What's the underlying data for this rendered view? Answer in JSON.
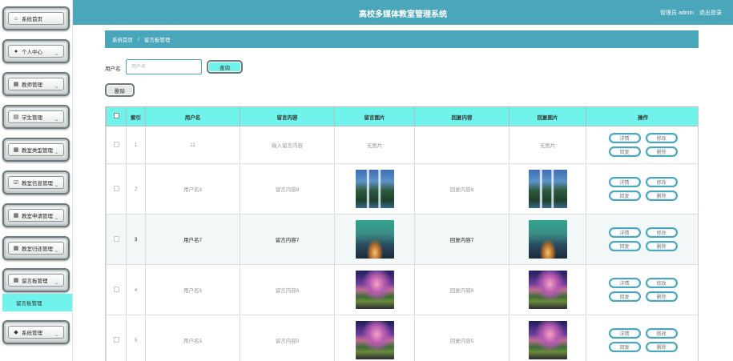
{
  "header": {
    "title": "高校多媒体教室管理系统",
    "user_label": "管理员 admin",
    "logout": "退出登录"
  },
  "sidebar": {
    "items": [
      {
        "label": "系统首页",
        "icon": "home-icon",
        "glyph": "⌂",
        "has_arrow": false
      },
      {
        "label": "个人中心",
        "icon": "user-icon",
        "glyph": "●",
        "has_arrow": true
      },
      {
        "label": "教师管理",
        "icon": "grid-icon",
        "glyph": "▦",
        "has_arrow": true
      },
      {
        "label": "学生管理",
        "icon": "briefcase-icon",
        "glyph": "▤",
        "has_arrow": true
      },
      {
        "label": "教室类型管理",
        "icon": "grid-icon",
        "glyph": "▦",
        "has_arrow": true
      },
      {
        "label": "教室信息管理",
        "icon": "checkbox-icon",
        "glyph": "☑",
        "has_arrow": true
      },
      {
        "label": "教室申请管理",
        "icon": "grid-icon",
        "glyph": "▦",
        "has_arrow": true
      },
      {
        "label": "教室归还管理",
        "icon": "grid-icon",
        "glyph": "▦",
        "has_arrow": true
      },
      {
        "label": "留言板管理",
        "icon": "grid-icon",
        "glyph": "▦",
        "has_arrow": true
      },
      {
        "label": "系统管理",
        "icon": "location-icon",
        "glyph": "◆",
        "has_arrow": true
      }
    ],
    "active_sub": "留言板管理"
  },
  "breadcrumb": {
    "home": "系统首页",
    "separator": "/",
    "current": "留言板管理"
  },
  "search": {
    "label": "用户名",
    "placeholder": "用户名",
    "button": "查询"
  },
  "actions": {
    "delete": "删除"
  },
  "table": {
    "headers": [
      "索引",
      "用户名",
      "留言内容",
      "留言图片",
      "回复内容",
      "回复图片",
      "操作"
    ],
    "rows": [
      {
        "index": "1",
        "user": "11",
        "content": "输入留言内容",
        "image": "无图片",
        "reply": "",
        "reply_image": "无图片",
        "image_kind": "none"
      },
      {
        "index": "2",
        "user": "用户名8",
        "content": "留言内容8",
        "image": "",
        "reply": "回复内容8",
        "reply_image": "",
        "image_kind": "waterfall"
      },
      {
        "index": "3",
        "user": "用户名7",
        "content": "留言内容7",
        "image": "",
        "reply": "回复内容7",
        "reply_image": "",
        "image_kind": "cabin"
      },
      {
        "index": "4",
        "user": "用户名6",
        "content": "留言内容6",
        "image": "",
        "reply": "回复内容6",
        "reply_image": "",
        "image_kind": "beach"
      },
      {
        "index": "5",
        "user": "用户名5",
        "content": "留言内容5",
        "image": "",
        "reply": "回复内容5",
        "reply_image": "",
        "image_kind": "beach"
      }
    ],
    "ops": {
      "detail": "详情",
      "edit": "修改",
      "reply": "回复",
      "delete": "删除"
    }
  },
  "colors": {
    "header_bg": "#4aa6ba",
    "accent_cyan": "#6ff3ea"
  }
}
